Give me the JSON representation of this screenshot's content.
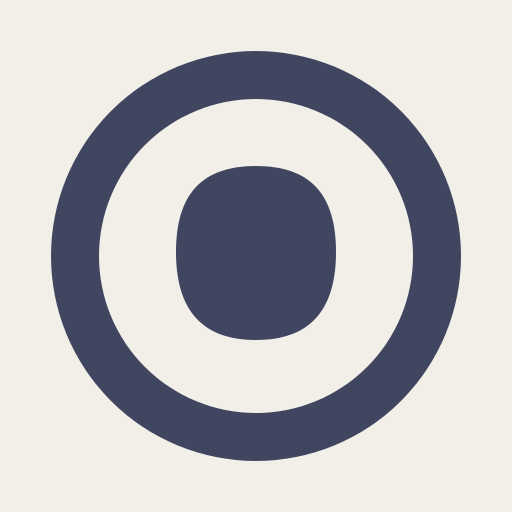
{
  "app": {
    "icon": {
      "name": "target-icon",
      "background_color": "#f2efe8",
      "foreground_color": "#414660"
    }
  }
}
